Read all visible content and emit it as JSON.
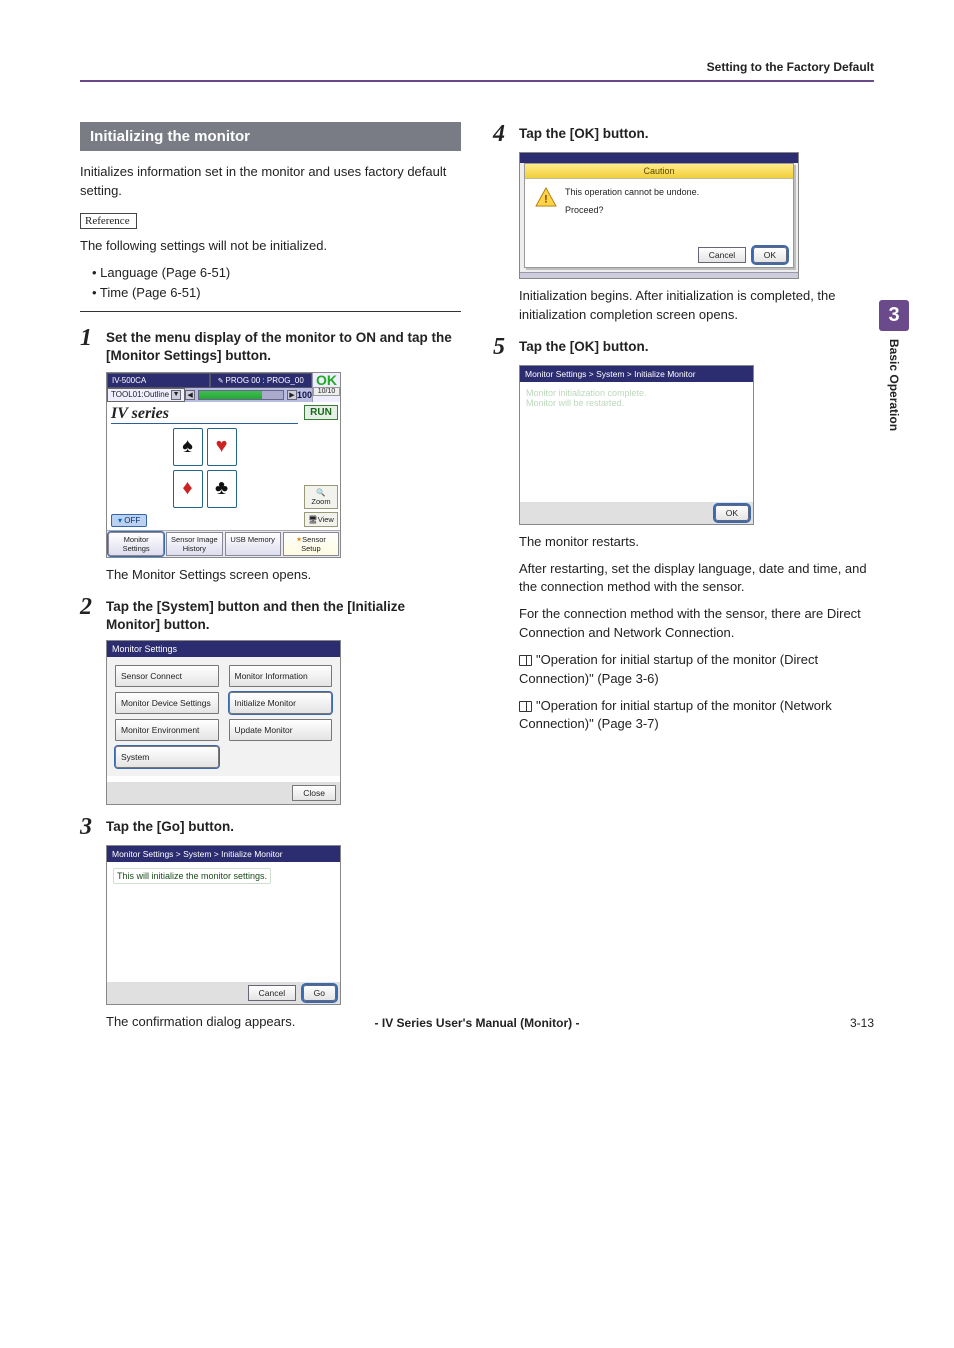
{
  "header": {
    "breadcrumb": "Setting to the Factory Default"
  },
  "sideTab": {
    "chapter": "3",
    "label": "Basic Operation"
  },
  "section": {
    "title": "Initializing the monitor",
    "intro": "Initializes information set in the monitor and uses factory default setting."
  },
  "reference": {
    "tag": "Reference",
    "lead": "The following settings will not be initialized.",
    "items": [
      "• Language (Page 6-51)",
      "• Time (Page 6-51)"
    ]
  },
  "steps": {
    "s1": {
      "num": "1",
      "text": "Set the menu display of the monitor to ON and tap the [Monitor Settings] button.",
      "after": "The Monitor Settings screen opens."
    },
    "s2": {
      "num": "2",
      "text": "Tap the [System] button and then the [Initialize Monitor] button."
    },
    "s3": {
      "num": "3",
      "text": "Tap the [Go] button.",
      "after": "The confirmation dialog appears."
    },
    "s4": {
      "num": "4",
      "text": "Tap the [OK] button.",
      "after": "Initialization begins. After initialization is completed, the initialization completion screen opens."
    },
    "s5": {
      "num": "5",
      "text": "Tap the [OK] button.",
      "after1": "The monitor restarts.",
      "after2": "After restarting, set the display language, date and time, and the connection method with the sensor.",
      "after3": "For the connection method with the sensor, there are Direct Connection and Network Connection.",
      "ref1": "\"Operation for initial startup of the monitor (Direct Connection)\" (Page 3-6)",
      "ref2": "\"Operation for initial startup of the monitor (Network Connection)\" (Page 3-7)"
    }
  },
  "screen1": {
    "topLeft": "IV-500CA",
    "topRight": "PROG 00 : PROG_00",
    "dropdown": "TOOL01:Outline",
    "score": "100",
    "okText": "OK",
    "ratio": "10/10",
    "run": "RUN",
    "ivSeries": "IV series",
    "zoom": "Zoom",
    "view": "View",
    "off": "OFF",
    "bot": {
      "monSettings": "Monitor Settings",
      "history": "Sensor Image History",
      "usb": "USB Memory",
      "setup": "Sensor Setup"
    }
  },
  "screen2": {
    "header": "Monitor Settings",
    "btns": {
      "sensorConnect": "Sensor Connect",
      "monInfo": "Monitor Information",
      "monDev": "Monitor Device Settings",
      "initMon": "Initialize Monitor",
      "monEnv": "Monitor Environment",
      "updMon": "Update Monitor",
      "system": "System"
    },
    "close": "Close"
  },
  "screen3": {
    "header": "Monitor Settings > System > Initialize Monitor",
    "msg": "This will initialize the monitor settings.",
    "cancel": "Cancel",
    "go": "Go"
  },
  "screen4": {
    "title": "Caution",
    "line1": "This operation cannot be undone.",
    "line2": "Proceed?",
    "cancel": "Cancel",
    "ok": "OK"
  },
  "screen5": {
    "header": "Monitor Settings > System > Initialize Monitor",
    "line1": "Monitor initialization complete.",
    "line2": "Monitor will be restarted.",
    "ok": "OK"
  },
  "footer": {
    "center": "- IV Series User's Manual (Monitor) -",
    "pageNum": "3-13"
  }
}
